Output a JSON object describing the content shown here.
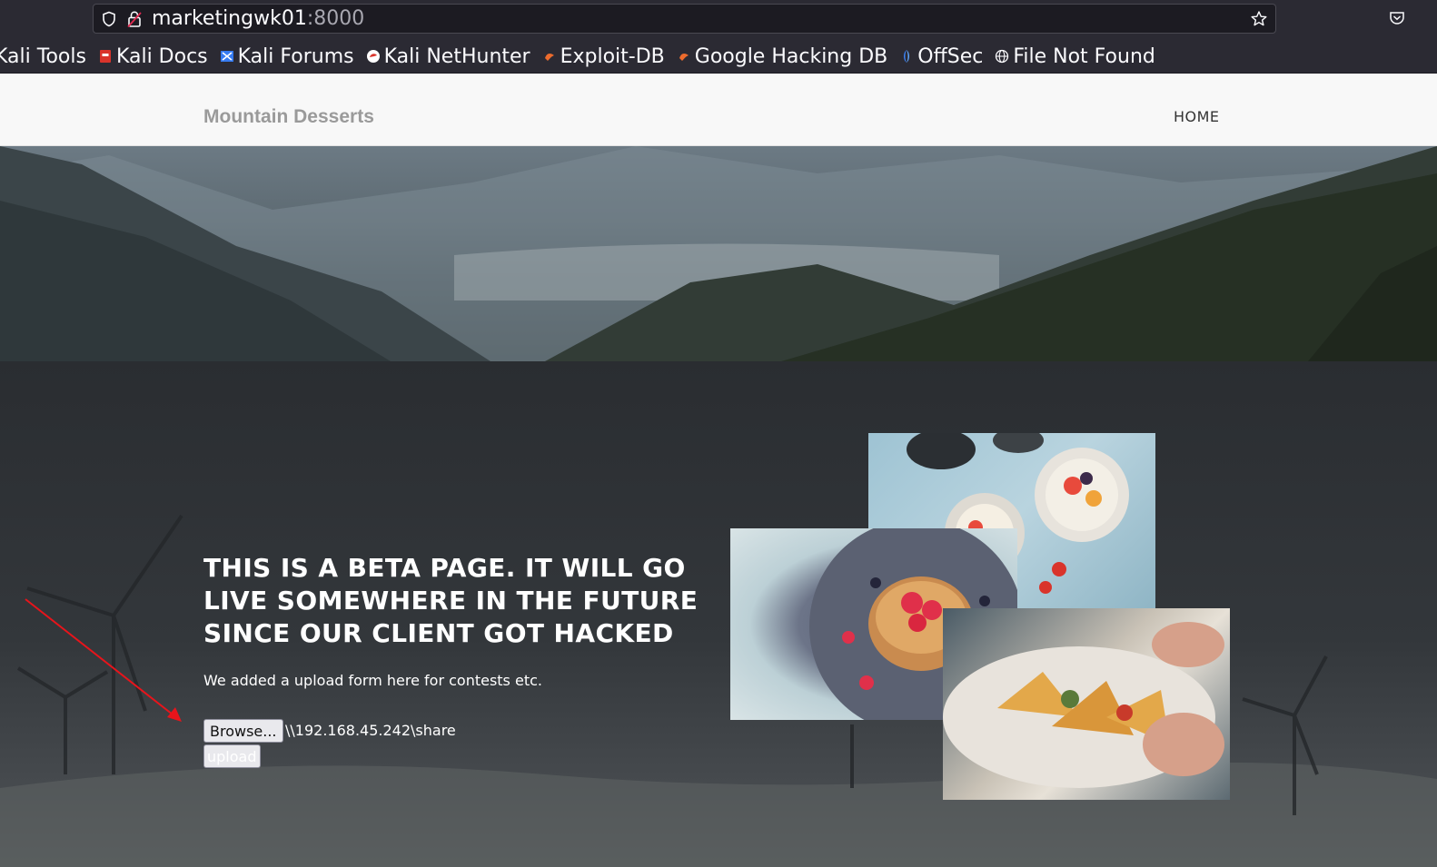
{
  "browser": {
    "url_host": "marketingwk01",
    "url_port": ":8000",
    "bookmarks": [
      {
        "label": "Kali Tools",
        "icon": "kali-tools-icon",
        "color": ""
      },
      {
        "label": "Kali Docs",
        "icon": "kali-docs-icon",
        "color": "#d9342b"
      },
      {
        "label": "Kali Forums",
        "icon": "kali-forums-icon",
        "color": "#367bf0"
      },
      {
        "label": "Kali NetHunter",
        "icon": "kali-nethunter-icon",
        "color": "#d9342b"
      },
      {
        "label": "Exploit-DB",
        "icon": "exploit-db-icon",
        "color": "#ec6b2d"
      },
      {
        "label": "Google Hacking DB",
        "icon": "ghdb-icon",
        "color": "#ec6b2d"
      },
      {
        "label": "OffSec",
        "icon": "offsec-icon",
        "color": "#3b82f6"
      },
      {
        "label": "File Not Found",
        "icon": "globe-icon",
        "color": "#fbfbfe"
      }
    ]
  },
  "site": {
    "brand": "Mountain Desserts",
    "nav": {
      "home": "HOME"
    }
  },
  "main": {
    "headline": "THIS IS A BETA PAGE. IT WILL GO LIVE SOMEWHERE IN THE FUTURE SINCE OUR CLIENT GOT HACKED",
    "subtext": "We added a upload form here for contests etc.",
    "form": {
      "browse_label": "Browse...",
      "file_value": "\\\\192.168.45.242\\share",
      "upload_label": "upload"
    }
  },
  "colors": {
    "annotation_arrow": "#e8141b"
  }
}
